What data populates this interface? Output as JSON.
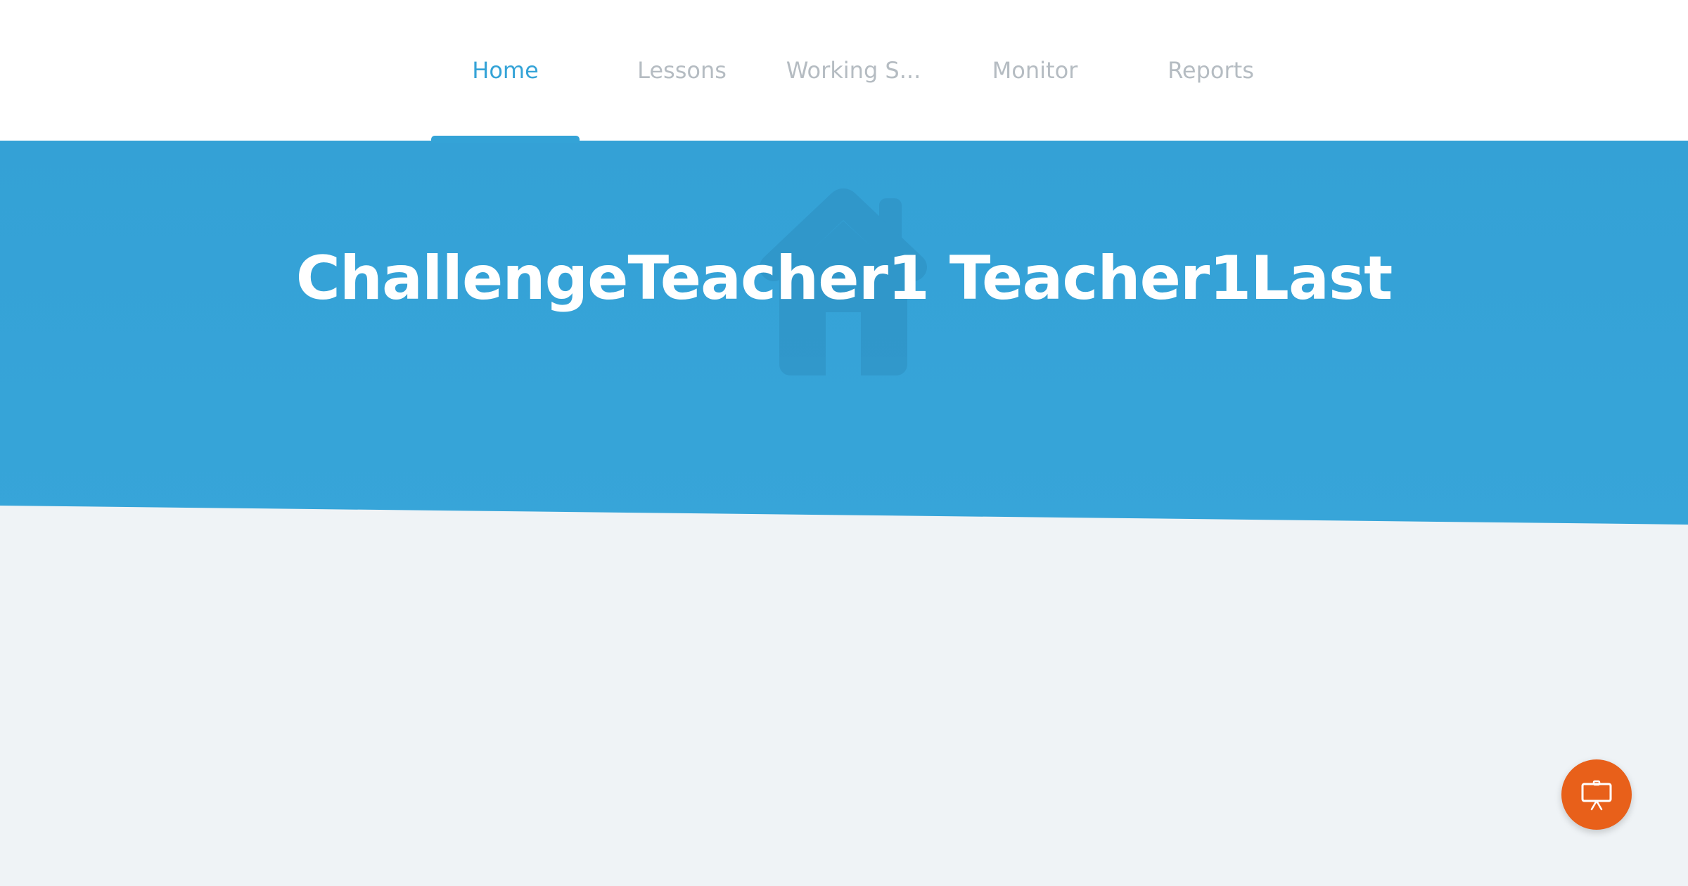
{
  "nav": {
    "tabs": [
      {
        "label": "Home",
        "active": true
      },
      {
        "label": "Lessons",
        "active": false
      },
      {
        "label": "Working S...",
        "active": false
      },
      {
        "label": "Monitor",
        "active": false
      },
      {
        "label": "Reports",
        "active": false
      }
    ]
  },
  "hero": {
    "title": "ChallengeTeacher1 Teacher1Last",
    "background_icon": "house-icon"
  },
  "fab": {
    "icon": "presentation-board-icon"
  },
  "colors": {
    "accent": "#34a3d7",
    "inactive_tab": "#b5bcc2",
    "page_background": "#eff3f6",
    "fab": "#e8601a"
  }
}
